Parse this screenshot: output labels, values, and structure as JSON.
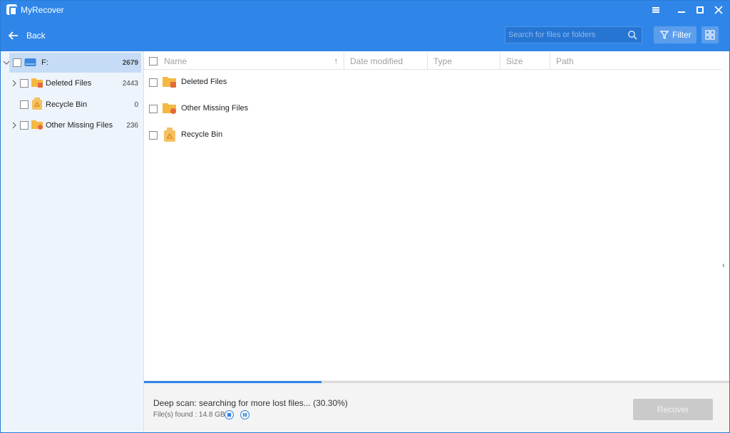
{
  "app": {
    "title": "MyRecover"
  },
  "toolbar": {
    "back_label": "Back",
    "search_placeholder": "Search for files or folders",
    "filter_label": "Filter",
    "view_icon": "grid-view-icon"
  },
  "window_controls": [
    "menu-icon",
    "minimize-icon",
    "maximize-icon",
    "close-icon"
  ],
  "sidebar": {
    "drive": {
      "label": "F:",
      "count": "2679"
    },
    "items": [
      {
        "label": "Deleted Files",
        "count": "2443",
        "icon": "folder-deleted-icon",
        "expandable": true
      },
      {
        "label": "Recycle Bin",
        "count": "0",
        "icon": "recycle-bin-icon",
        "expandable": false
      },
      {
        "label": "Other Missing Files",
        "count": "236",
        "icon": "folder-missing-icon",
        "expandable": true
      }
    ]
  },
  "table": {
    "columns": [
      "Name",
      "Date modified",
      "Type",
      "Size",
      "Path"
    ],
    "rows": [
      {
        "name": "Deleted Files",
        "icon": "folder-deleted-icon"
      },
      {
        "name": "Other Missing Files",
        "icon": "folder-missing-icon"
      },
      {
        "name": "Recycle Bin",
        "icon": "recycle-bin-icon"
      }
    ]
  },
  "status": {
    "scan_text": "Deep scan: searching for more lost files... (30.30%)",
    "progress": 0.303,
    "found_text": "File(s) found : 14.8 GB",
    "recover_label": "Recover"
  },
  "colors": {
    "header": "#2f86e8",
    "sidebar": "#eef4fc",
    "selected_row": "#c6dcf6",
    "progress": "#2f86e8",
    "recover_disabled": "#cacaca"
  }
}
